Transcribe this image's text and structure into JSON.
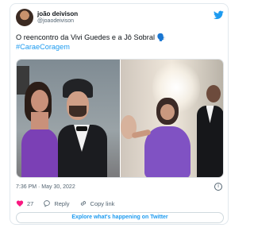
{
  "tweet": {
    "author_name": "joão deivison",
    "author_handle": "@joaodeivison",
    "text": "O reencontro da Vivi Guedes e a Jô Sobral 🗣️",
    "hashtag": "#CaraeCoragem",
    "timestamp": "7:36 PM · May 30, 2022",
    "like_count": "27",
    "reply_label": "Reply",
    "copy_link_label": "Copy link",
    "explore_label": "Explore what's happening on Twitter",
    "info_glyph": "i"
  },
  "colors": {
    "accent": "#1d9bf0",
    "like": "#f91880",
    "text": "#0f1419",
    "secondary": "#536471"
  },
  "icons": [
    "avatar",
    "twitter-bird-icon",
    "heart-icon",
    "reply-icon",
    "link-icon",
    "info-icon"
  ]
}
